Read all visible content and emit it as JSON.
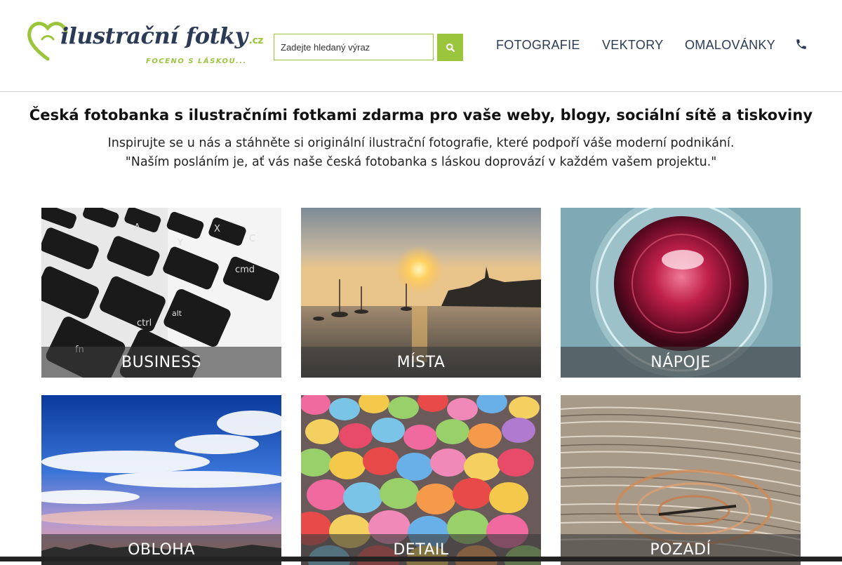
{
  "brand": {
    "wordmark": "ilustrační fotky",
    "tld": ".cz",
    "tagline": "FOCENO S LÁSKOU...",
    "accent_color": "#9bc53d",
    "navy_color": "#2b3a55"
  },
  "search": {
    "placeholder": "Zadejte hledaný výraz",
    "button_icon": "search-icon"
  },
  "nav": {
    "items": [
      {
        "label": "FOTOGRAFIE"
      },
      {
        "label": "VEKTORY"
      },
      {
        "label": "OMALOVÁNKY"
      }
    ],
    "phone_icon": "phone-icon"
  },
  "intro": {
    "title": "Česká fotobanka s ilustračními fotkami zdarma pro vaše weby, blogy, sociální sítě a tiskoviny",
    "line1": "Inspirujte se u nás a stáhněte si originální ilustrační fotografie, které podpoří váše moderní podnikání.",
    "line2": "\"Naším posláním je, ať vás naše česká fotobanka s láskou doprovází v každém vašem projektu.\""
  },
  "categories": [
    {
      "label": "BUSINESS"
    },
    {
      "label": "MÍSTA"
    },
    {
      "label": "NÁPOJE"
    },
    {
      "label": "OBLOHA"
    },
    {
      "label": "DETAIL"
    },
    {
      "label": "POZADÍ"
    }
  ]
}
